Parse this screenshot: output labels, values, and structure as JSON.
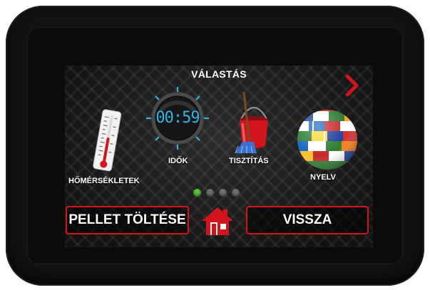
{
  "screen": {
    "title": "VÁLASTÁS"
  },
  "menu": [
    {
      "label": "HŐMÉRSÉKLETEK",
      "icon": "thermometer-icon"
    },
    {
      "label": "IDŐK",
      "icon": "clock-icon"
    },
    {
      "label": "TISZTÍTÁS",
      "icon": "cleaning-bucket-icon"
    },
    {
      "label": "NYELV",
      "icon": "flag-globe-icon"
    }
  ],
  "clock": {
    "time": "00:59"
  },
  "pager": {
    "pages": 4,
    "active": 1
  },
  "buttons": {
    "pellet": "PELLET TÖLTÉSE",
    "back": "VISSZA",
    "home_icon": "home-icon"
  },
  "colors": {
    "accent": "#d4141d",
    "digits": "#2fb6e8",
    "active_dot": "#58c23a"
  }
}
